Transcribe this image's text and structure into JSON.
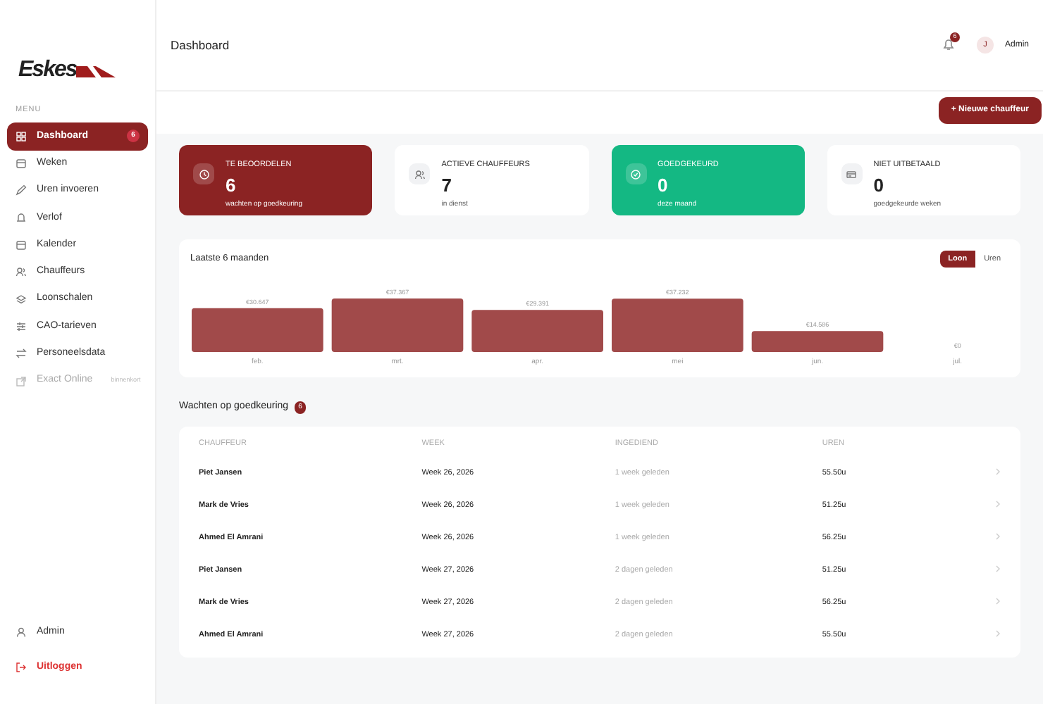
{
  "sidebar": {
    "logo": "Eskes",
    "section": "MENU",
    "items": [
      {
        "label": "Dashboard",
        "selected": true,
        "disabled": false,
        "badge": "6"
      },
      {
        "label": "Weken",
        "selected": false,
        "disabled": false
      },
      {
        "label": "Uren invoeren",
        "selected": false,
        "disabled": false
      },
      {
        "label": "Verlof",
        "selected": false,
        "disabled": false
      },
      {
        "label": "Kalender",
        "selected": false,
        "disabled": false
      },
      {
        "label": "Chauffeurs",
        "selected": false,
        "disabled": false
      },
      {
        "label": "Loonschalen",
        "selected": false,
        "disabled": false
      },
      {
        "label": "CAO-tarieven",
        "selected": false,
        "disabled": false
      },
      {
        "label": "Personeelsdata",
        "selected": false,
        "disabled": false
      },
      {
        "label": "Exact Online",
        "selected": false,
        "disabled": true,
        "note": "binnenkort"
      }
    ],
    "footer": [
      {
        "label": "Admin",
        "kind": "user"
      },
      {
        "label": "Uitloggen",
        "kind": "logout"
      }
    ]
  },
  "header": {
    "title": "Dashboard",
    "notifications": "6",
    "avatar": "J",
    "user": "Admin"
  },
  "action_button": "+ Nieuwe chauffeur",
  "stats": [
    {
      "label": "TE BEOORDELEN",
      "value": "6",
      "sub": "wachten op goedkeuring",
      "kind": "alert"
    },
    {
      "label": "ACTIEVE CHAUFFEURS",
      "value": "7",
      "sub": "in dienst",
      "kind": "plain"
    },
    {
      "label": "GOEDGEKEURD",
      "value": "0",
      "sub": "deze maand",
      "kind": "success"
    },
    {
      "label": "NIET UITBETAALD",
      "value": "0",
      "sub": "goedgekeurde weken",
      "kind": "plain"
    }
  ],
  "chart_card": {
    "title": "Laatste 6 maanden",
    "toggle": [
      {
        "label": "Loon",
        "selected": true
      },
      {
        "label": "Uren",
        "selected": false
      }
    ],
    "chart_data": {
      "type": "bar",
      "categories": [
        "feb.",
        "mrt.",
        "apr.",
        "mei",
        "jun.",
        "jul."
      ],
      "values": [
        30.647,
        37.367,
        29.391,
        37.232,
        14.586,
        0
      ],
      "value_labels": [
        "€30.647",
        "€37.367",
        "€29.391",
        "€37.232",
        "€14.586",
        "€0"
      ]
    }
  },
  "approvals": {
    "title": "Wachten op goedkeuring",
    "count": "6",
    "columns": [
      "CHAUFFEUR",
      "WEEK",
      "INGEDIEND",
      "UREN"
    ],
    "rows": [
      [
        "Piet Jansen",
        "Week 26, 2026",
        "1 week geleden",
        "55.50u"
      ],
      [
        "Mark de Vries",
        "Week 26, 2026",
        "1 week geleden",
        "51.25u"
      ],
      [
        "Ahmed El Amrani",
        "Week 26, 2026",
        "1 week geleden",
        "56.25u"
      ],
      [
        "Piet Jansen",
        "Week 27, 2026",
        "2 dagen geleden",
        "51.25u"
      ],
      [
        "Mark de Vries",
        "Week 27, 2026",
        "2 dagen geleden",
        "56.25u"
      ],
      [
        "Ahmed El Amrani",
        "Week 27, 2026",
        "2 dagen geleden",
        "55.50u"
      ]
    ]
  }
}
